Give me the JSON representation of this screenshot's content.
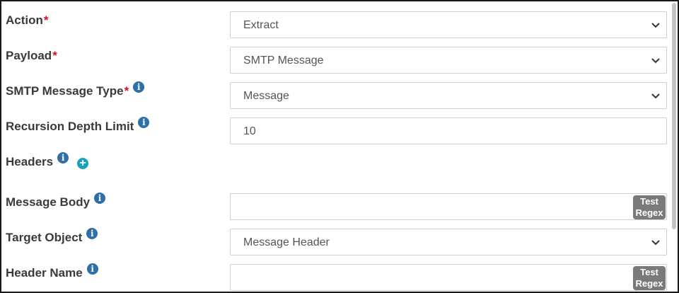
{
  "form": {
    "action": {
      "label": "Action",
      "required": "*",
      "value": "Extract"
    },
    "payload": {
      "label": "Payload",
      "required": "*",
      "value": "SMTP Message"
    },
    "smtp_message_type": {
      "label": "SMTP Message Type",
      "required": "*",
      "value": "Message"
    },
    "recursion_depth_limit": {
      "label": "Recursion Depth Limit",
      "value": "10"
    },
    "headers": {
      "label": "Headers"
    },
    "message_body": {
      "label": "Message Body",
      "value": "",
      "test_regex_label": "Test Regex"
    },
    "target_object": {
      "label": "Target Object",
      "value": "Message Header"
    },
    "header_name": {
      "label": "Header Name",
      "value": "",
      "test_regex_label": "Test Regex"
    }
  },
  "icons": {
    "info": "info-icon",
    "add": "plus-circle-icon",
    "dropdown": "chevron-down-icon"
  },
  "colors": {
    "required": "#d0102b",
    "info": "#2f6fa8",
    "add": "#17a2b8",
    "regex_button": "#7a7a7a"
  }
}
